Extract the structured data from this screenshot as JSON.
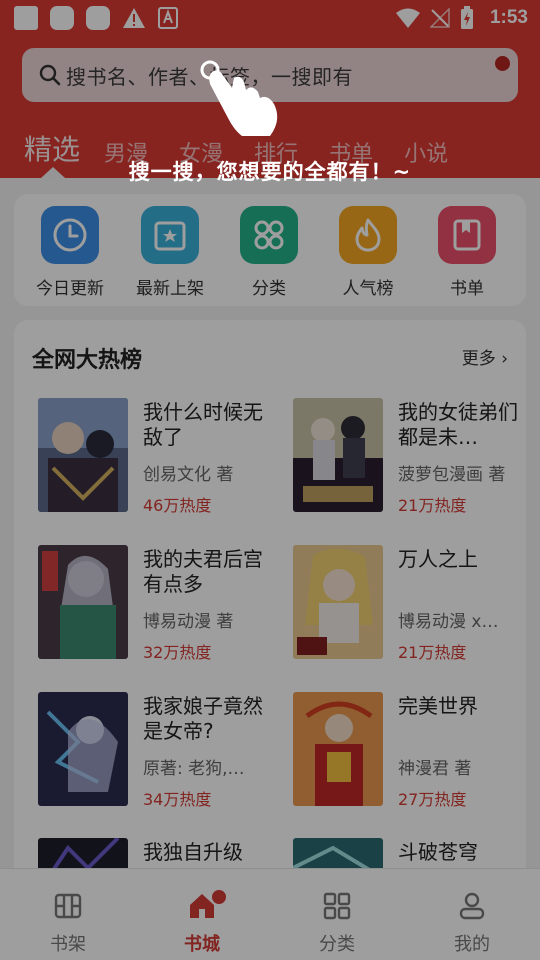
{
  "status_bar": {
    "time": "1:53"
  },
  "search": {
    "placeholder": "搜书名、作者、标签，一搜即有"
  },
  "tabs": [
    {
      "label": "精选",
      "active": true
    },
    {
      "label": "男漫"
    },
    {
      "label": "女漫"
    },
    {
      "label": "排行"
    },
    {
      "label": "书单"
    },
    {
      "label": "小说"
    }
  ],
  "hint": {
    "text": "搜一搜，您想要的全都有！~"
  },
  "quick_links": [
    {
      "label": "今日更新",
      "icon": "clock-icon",
      "color": "#3d8fe6"
    },
    {
      "label": "最新上架",
      "icon": "star-box-icon",
      "color": "#3ab0d8"
    },
    {
      "label": "分类",
      "icon": "grid-icon",
      "color": "#24b48a"
    },
    {
      "label": "人气榜",
      "icon": "flame-icon",
      "color": "#f5a623"
    },
    {
      "label": "书单",
      "icon": "bookmark-book-icon",
      "color": "#ea4f6a"
    }
  ],
  "hot_list": {
    "title": "全网大热榜",
    "more": "更多",
    "books": [
      {
        "title": "我什么时候无敌了",
        "author": "创易文化 著",
        "heat": "46万热度"
      },
      {
        "title": "我的女徒弟们都是未…",
        "author": "菠萝包漫画 著",
        "heat": "21万热度"
      },
      {
        "title": "我的夫君后宫有点多",
        "author": "博易动漫 著",
        "heat": "32万热度"
      },
      {
        "title": "万人之上",
        "author": "博易动漫 x…",
        "heat": "21万热度"
      },
      {
        "title": "我家娘子竟然是女帝?",
        "author": "原著: 老狗,…",
        "heat": "34万热度"
      },
      {
        "title": "完美世界",
        "author": "神漫君 著",
        "heat": "27万热度"
      },
      {
        "title": "我独自升级",
        "author": "",
        "heat": ""
      },
      {
        "title": "斗破苍穹",
        "author": "",
        "heat": ""
      }
    ]
  },
  "bottom_nav": [
    {
      "label": "书架",
      "icon": "bookshelf-icon"
    },
    {
      "label": "书城",
      "icon": "home-icon",
      "active": true
    },
    {
      "label": "分类",
      "icon": "category-grid-icon"
    },
    {
      "label": "我的",
      "icon": "profile-icon"
    }
  ],
  "colors": {
    "brand": "#dc3a35",
    "heat": "#d23a35"
  }
}
